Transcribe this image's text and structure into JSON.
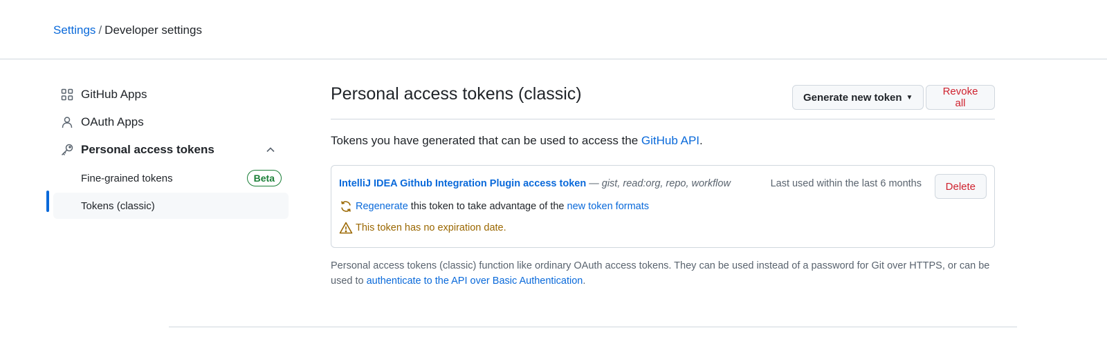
{
  "breadcrumb": {
    "settings": "Settings",
    "separator": "/",
    "current": "Developer settings"
  },
  "sidebar": {
    "items": [
      {
        "label": "GitHub Apps",
        "icon": "apps-grid-icon"
      },
      {
        "label": "OAuth Apps",
        "icon": "person-icon"
      },
      {
        "label": "Personal access tokens",
        "icon": "key-icon",
        "expanded": true
      }
    ],
    "sub_items": [
      {
        "label": "Fine-grained tokens",
        "badge": "Beta"
      },
      {
        "label": "Tokens (classic)",
        "active": true
      }
    ]
  },
  "main": {
    "title": "Personal access tokens (classic)",
    "generate_button": "Generate new token",
    "revoke_button": "Revoke all",
    "intro_text": "Tokens you have generated that can be used to access the ",
    "intro_link": "GitHub API",
    "intro_end": ".",
    "token": {
      "name": "IntelliJ IDEA Github Integration Plugin access token",
      "dash": " — ",
      "scopes": "gist, read:org, repo, workflow",
      "last_used": "Last used within the last 6 months",
      "delete_button": "Delete",
      "regen_link": "Regenerate",
      "regen_text": " this token to take advantage of the ",
      "regen_link2": "new token formats",
      "warning": "This token has no expiration date."
    },
    "footnote_text": "Personal access tokens (classic) function like ordinary OAuth access tokens. They can be used instead of a password for Git over HTTPS, or can be used to ",
    "footnote_link": "authenticate to the API over Basic Authentication",
    "footnote_end": "."
  },
  "colors": {
    "link": "#0969da",
    "danger": "#cf222e",
    "success": "#1a7f37",
    "attention": "#9a6700",
    "border": "#d0d7de"
  }
}
